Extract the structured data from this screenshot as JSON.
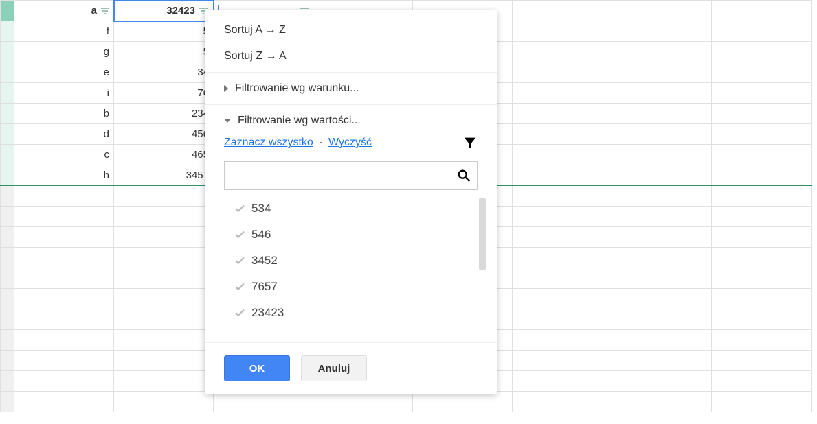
{
  "headers": {
    "colA": "a",
    "colB": "32423",
    "colC": ""
  },
  "rows": [
    {
      "a": "f",
      "b": "5"
    },
    {
      "a": "g",
      "b": "5"
    },
    {
      "a": "e",
      "b": "34"
    },
    {
      "a": "i",
      "b": "76"
    },
    {
      "a": "b",
      "b": "234"
    },
    {
      "a": "d",
      "b": "456"
    },
    {
      "a": "c",
      "b": "465"
    },
    {
      "a": "h",
      "b": "3457"
    }
  ],
  "menu": {
    "sortAZ": "Sortuj A → Z",
    "sortZA": "Sortuj Z → A",
    "filterByCondition": "Filtrowanie wg warunku...",
    "filterByValue": "Filtrowanie wg wartości...",
    "selectAll": "Zaznacz wszystko",
    "dash": "-",
    "clear": "Wyczyść",
    "searchPlaceholder": "",
    "values": [
      "534",
      "546",
      "3452",
      "7657",
      "23423"
    ],
    "ok": "OK",
    "cancel": "Anuluj"
  }
}
